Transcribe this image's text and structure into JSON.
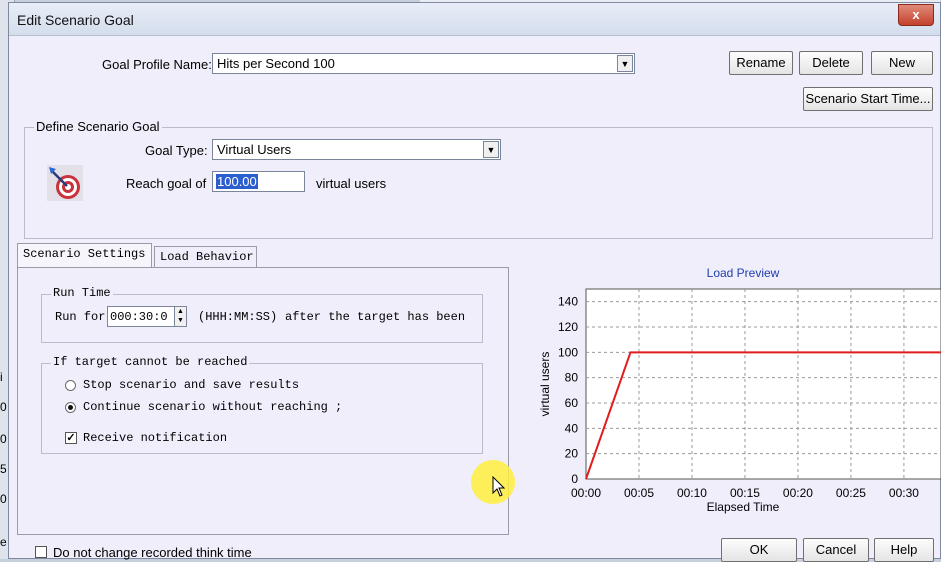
{
  "dialog": {
    "title": "Edit Scenario Goal",
    "close_glyph": "x"
  },
  "goal_profile": {
    "label": "Goal Profile Name:",
    "value": "Hits per Second 100",
    "rename": "Rename",
    "delete": "Delete",
    "new": "New",
    "start_time": "Scenario Start Time..."
  },
  "define_goal": {
    "title": "Define Scenario Goal",
    "goal_type_label": "Goal Type:",
    "goal_type_value": "Virtual Users",
    "reach_label": "Reach goal of",
    "reach_value": "100.00",
    "reach_unit": "virtual users"
  },
  "tabs": [
    {
      "label": "Scenario Settings"
    },
    {
      "label": "Load Behavior"
    }
  ],
  "run_time": {
    "title": "Run Time",
    "run_for": "Run for",
    "value": "000:30:0",
    "format": "(HHH:MM:SS)",
    "after": "after the target has been"
  },
  "target": {
    "title": "If target cannot be reached",
    "stop": "Stop scenario and save results",
    "continue": "Continue scenario without reaching ;",
    "notify": "Receive notification",
    "selected": "continue",
    "notify_checked": true
  },
  "footer": {
    "think_time": "Do not change recorded think time",
    "ok": "OK",
    "cancel": "Cancel",
    "help": "Help"
  },
  "chart_data": {
    "type": "line",
    "title": "Load Preview",
    "xlabel": "Elapsed Time",
    "ylabel": "virtual users",
    "x_ticks": [
      "00:00",
      "00:05",
      "00:10",
      "00:15",
      "00:20",
      "00:25",
      "00:30"
    ],
    "y_ticks": [
      0,
      20,
      40,
      60,
      80,
      100,
      120,
      140
    ],
    "xlim_minutes": [
      0,
      33.5
    ],
    "ylim": [
      0,
      150
    ],
    "grid": true,
    "series": [
      {
        "x_minutes": [
          0,
          4.2,
          33.5
        ],
        "y": [
          0,
          100,
          100
        ],
        "color": "#e11c1c"
      }
    ]
  },
  "colors": {
    "accent_title": "#1f3fae",
    "series_line": "#e11c1c",
    "selection": "#2c5fce"
  },
  "icons": {
    "target": "target-dart-icon",
    "spin": "spin-updown-icon",
    "dropdown": "chevron-down-icon"
  }
}
